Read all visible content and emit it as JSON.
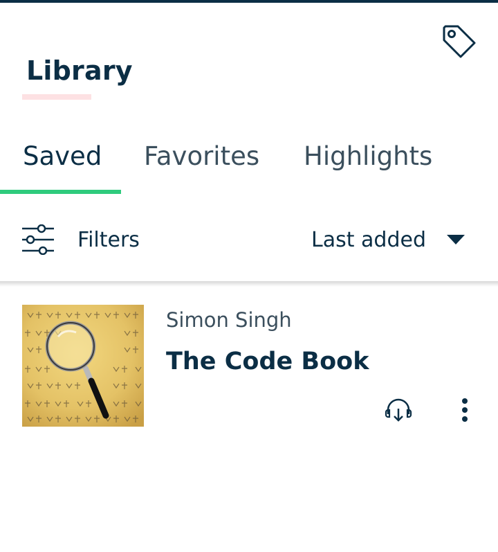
{
  "header": {
    "title": "Library",
    "tag_icon": "tag-icon"
  },
  "tabs": [
    {
      "label": "Saved",
      "active": true
    },
    {
      "label": "Favorites",
      "active": false
    },
    {
      "label": "Highlights",
      "active": false
    }
  ],
  "filters": {
    "label": "Filters",
    "icon": "sliders-icon",
    "sort_label": "Last added",
    "sort_icon": "caret-down-icon"
  },
  "books": [
    {
      "author": "Simon Singh",
      "title": "The Code Book",
      "cover_icon": "magnifying-glass-cover",
      "actions": [
        "audio-download-icon",
        "more-vertical-icon"
      ]
    }
  ],
  "colors": {
    "primary_text": "#0b2e45",
    "secondary_text": "#3b4f5d",
    "accent_green": "#2fcb7d",
    "title_underline": "#fde1e3"
  }
}
